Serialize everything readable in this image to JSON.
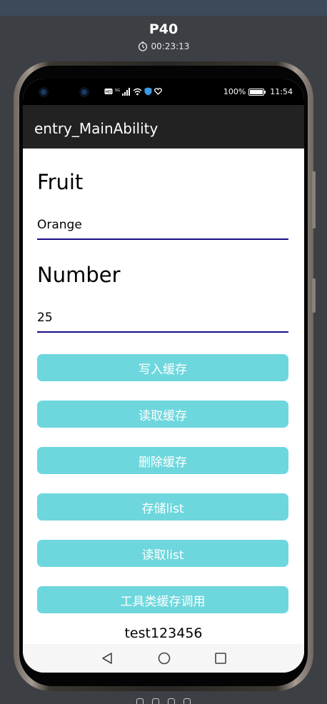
{
  "device": {
    "name": "P40",
    "timer": "00:23:13"
  },
  "status_bar": {
    "battery": "100%",
    "time": "11:54"
  },
  "app_bar": {
    "title": "entry_MainAbility"
  },
  "form": {
    "fruit_label": "Fruit",
    "fruit_value": "Orange",
    "number_label": "Number",
    "number_value": "25"
  },
  "buttons": {
    "write_cache": "写入缓存",
    "read_cache": "读取缓存",
    "delete_cache": "删除缓存",
    "store_list": "存储list",
    "read_list": "读取list",
    "util_cache": "工具类缓存调用"
  },
  "result_text": "test123456",
  "colors": {
    "button": "#6dd7dd",
    "underline": "#1a0f8a",
    "app_bar": "#222222"
  }
}
